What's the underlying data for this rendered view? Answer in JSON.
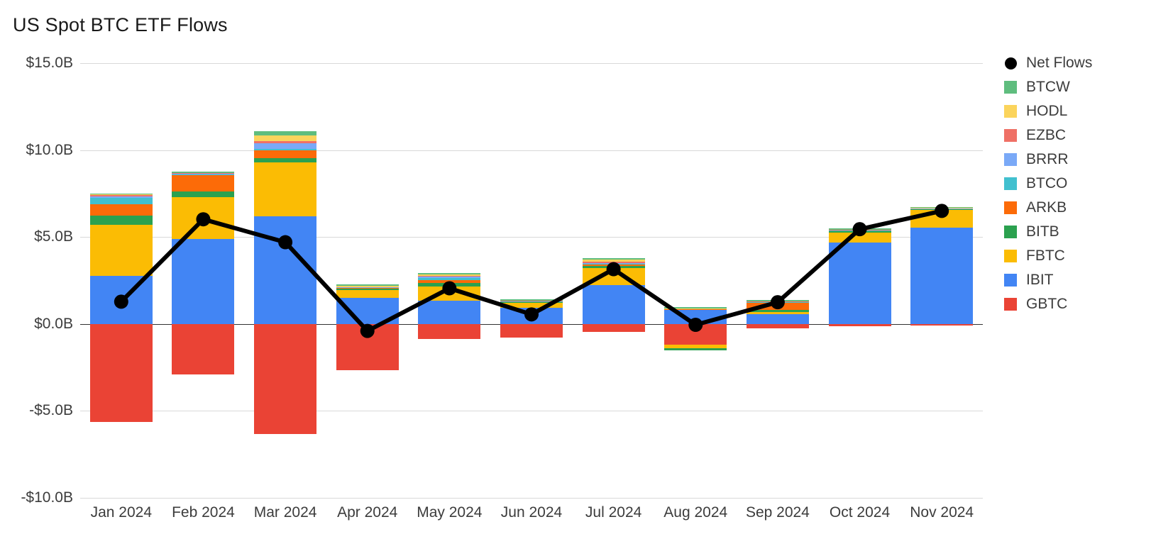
{
  "chart": {
    "title": "US Spot BTC ETF Flows"
  },
  "axes": {
    "y_ticks": [
      "$15.0B",
      "$10.0B",
      "$5.0B",
      "$0.0B",
      "-$5.0B",
      "-$10.0B"
    ],
    "y_values": [
      15,
      10,
      5,
      0,
      -5,
      -10
    ],
    "x_ticks": [
      "Jan 2024",
      "Feb 2024",
      "Mar 2024",
      "Apr 2024",
      "May 2024",
      "Jun 2024",
      "Jul 2024",
      "Aug 2024",
      "Sep 2024",
      "Oct 2024",
      "Nov 2024"
    ]
  },
  "legend": {
    "position": "right",
    "items": [
      {
        "label": "Net Flows",
        "color": "#000000",
        "marker": "dot"
      },
      {
        "label": "BTCW",
        "color": "#5fbd7e",
        "marker": "square"
      },
      {
        "label": "HODL",
        "color": "#fbd45c",
        "marker": "square"
      },
      {
        "label": "EZBC",
        "color": "#ef7066",
        "marker": "square"
      },
      {
        "label": "BRRR",
        "color": "#7aa9f7",
        "marker": "square"
      },
      {
        "label": "BTCO",
        "color": "#41c0cf",
        "marker": "square"
      },
      {
        "label": "ARKB",
        "color": "#fc6b08",
        "marker": "square"
      },
      {
        "label": "BITB",
        "color": "#2ba14f",
        "marker": "square"
      },
      {
        "label": "FBTC",
        "color": "#fbbc04",
        "marker": "square"
      },
      {
        "label": "IBIT",
        "color": "#4285f4",
        "marker": "square"
      },
      {
        "label": "GBTC",
        "color": "#ea4335",
        "marker": "square"
      }
    ]
  },
  "chart_data": {
    "type": "bar",
    "stacked": true,
    "title": "US Spot BTC ETF Flows",
    "xlabel": "",
    "ylabel": "",
    "ylim": [
      -10,
      15
    ],
    "grid": true,
    "unit": "billions USD",
    "categories": [
      "Jan 2024",
      "Feb 2024",
      "Mar 2024",
      "Apr 2024",
      "May 2024",
      "Jun 2024",
      "Jul 2024",
      "Aug 2024",
      "Sep 2024",
      "Oct 2024",
      "Nov 2024"
    ],
    "series": [
      {
        "name": "GBTC",
        "color": "#ea4335",
        "values": [
          -5.65,
          -2.9,
          -6.35,
          -2.65,
          -0.85,
          -0.8,
          -0.45,
          -1.2,
          -0.25,
          -0.12,
          -0.1
        ]
      },
      {
        "name": "IBIT",
        "color": "#4285f4",
        "values": [
          2.75,
          4.9,
          6.2,
          1.5,
          1.35,
          0.95,
          2.25,
          0.85,
          0.55,
          4.7,
          5.55
        ]
      },
      {
        "name": "FBTC",
        "color": "#fbbc04",
        "values": [
          2.95,
          2.4,
          3.1,
          0.45,
          0.8,
          0.25,
          0.95,
          -0.2,
          0.12,
          0.55,
          1.0
        ]
      },
      {
        "name": "BITB",
        "color": "#2ba14f",
        "values": [
          0.55,
          0.3,
          0.25,
          0.1,
          0.22,
          0.06,
          0.12,
          -0.12,
          0.12,
          0.08,
          0.05
        ]
      },
      {
        "name": "ARKB",
        "color": "#fc6b08",
        "values": [
          0.65,
          1.0,
          0.45,
          0.05,
          0.16,
          0.05,
          0.12,
          0.03,
          0.45,
          0.06,
          0.04
        ]
      },
      {
        "name": "BTCO",
        "color": "#41c0cf",
        "values": [
          0.35,
          0.03,
          0.05,
          0.02,
          0.1,
          0.02,
          0.04,
          0.01,
          0.03,
          0.02,
          0.02
        ]
      },
      {
        "name": "BRRR",
        "color": "#7aa9f7",
        "values": [
          0.1,
          0.04,
          0.35,
          0.02,
          0.08,
          0.02,
          0.05,
          0.01,
          0.03,
          0.02,
          0.02
        ]
      },
      {
        "name": "EZBC",
        "color": "#ef7066",
        "values": [
          0.06,
          0.03,
          0.1,
          0.02,
          0.06,
          0.02,
          0.04,
          0.01,
          0.02,
          0.02,
          0.02
        ]
      },
      {
        "name": "HODL",
        "color": "#fbd45c",
        "values": [
          0.08,
          0.04,
          0.35,
          0.03,
          0.07,
          0.02,
          0.18,
          0.01,
          0.03,
          0.02,
          0.02
        ]
      },
      {
        "name": "BTCW",
        "color": "#5fbd7e",
        "values": [
          0.02,
          0.02,
          0.25,
          0.1,
          0.08,
          0.02,
          0.03,
          0.05,
          0.02,
          0.01,
          0.01
        ]
      }
    ],
    "overlay": {
      "name": "Net Flows",
      "type": "line",
      "color": "#000000",
      "marker": "circle",
      "values": [
        1.28,
        6.02,
        4.7,
        -0.4,
        2.05,
        0.55,
        3.15,
        -0.05,
        1.25,
        5.45,
        6.5
      ]
    }
  }
}
